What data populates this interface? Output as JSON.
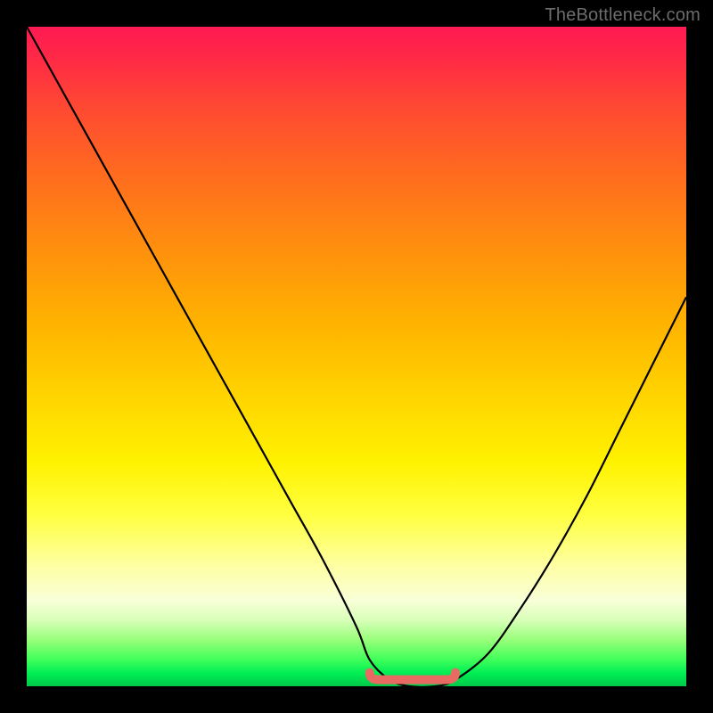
{
  "watermark": "TheBottleneck.com",
  "chart_data": {
    "type": "line",
    "title": "",
    "xlabel": "",
    "ylabel": "",
    "xlim": [
      0,
      100
    ],
    "ylim": [
      0,
      100
    ],
    "grid": false,
    "series": [
      {
        "name": "curve",
        "x": [
          0,
          5,
          10,
          15,
          20,
          25,
          30,
          35,
          40,
          45,
          50,
          52,
          55,
          58,
          62,
          65,
          70,
          75,
          80,
          85,
          90,
          95,
          100
        ],
        "values": [
          100,
          91,
          82,
          73,
          64,
          55,
          46,
          37,
          28,
          19,
          9,
          4,
          1,
          0,
          0,
          1,
          5,
          12,
          20,
          29,
          39,
          49,
          59
        ]
      }
    ],
    "flat_zone": {
      "x_start": 52,
      "x_end": 65,
      "y": 1
    }
  },
  "colors": {
    "curve": "#000000",
    "flat_marker": "#e86a63",
    "background_top": "#ff1a53",
    "background_bottom": "#00c94a"
  }
}
